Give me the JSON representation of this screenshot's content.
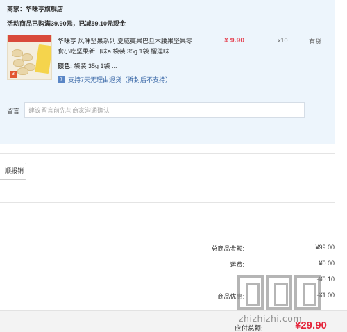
{
  "store": {
    "shop_label": "商家：华味亨旗舰店",
    "promo_label": "活动商品已购满39.90元，已减59.10元现金"
  },
  "product": {
    "title": "华味亨 风味坚果系列 夏威夷果巴旦木腰果坚果零食小吃坚果新口味a 袋装 35g 1袋 榴莲味",
    "price": "¥ 9.90",
    "quantity": "x10",
    "stock_status": "有货",
    "attr_key": "颜色:",
    "attr_value": "袋装 35g 1袋 ...",
    "return_policy": "支持7天无理由退货（拆封后不支持）",
    "thumb_badge": "3",
    "return_icon_glyph": "7"
  },
  "memo": {
    "label": "留言:",
    "placeholder": "建议留言前先与商家沟通确认"
  },
  "invoice": {
    "button_label": "顺报销"
  },
  "summary": {
    "rows": [
      {
        "label": "总商品金额:",
        "value": "¥99.00"
      },
      {
        "label": "运费:",
        "value": "¥0.00"
      },
      {
        "label": "",
        "value": "-¥0.10"
      },
      {
        "label": "商品优惠:",
        "value": "-¥1.00"
      }
    ],
    "total_label": "应付总额:",
    "total_value": "¥29.90"
  },
  "watermark": {
    "text": "zhizhizhi.com"
  },
  "colors": {
    "panel_bg": "#edf5fc",
    "price_red": "#e5404f",
    "link_blue": "#3b69a8",
    "total_red": "#e5253b"
  }
}
